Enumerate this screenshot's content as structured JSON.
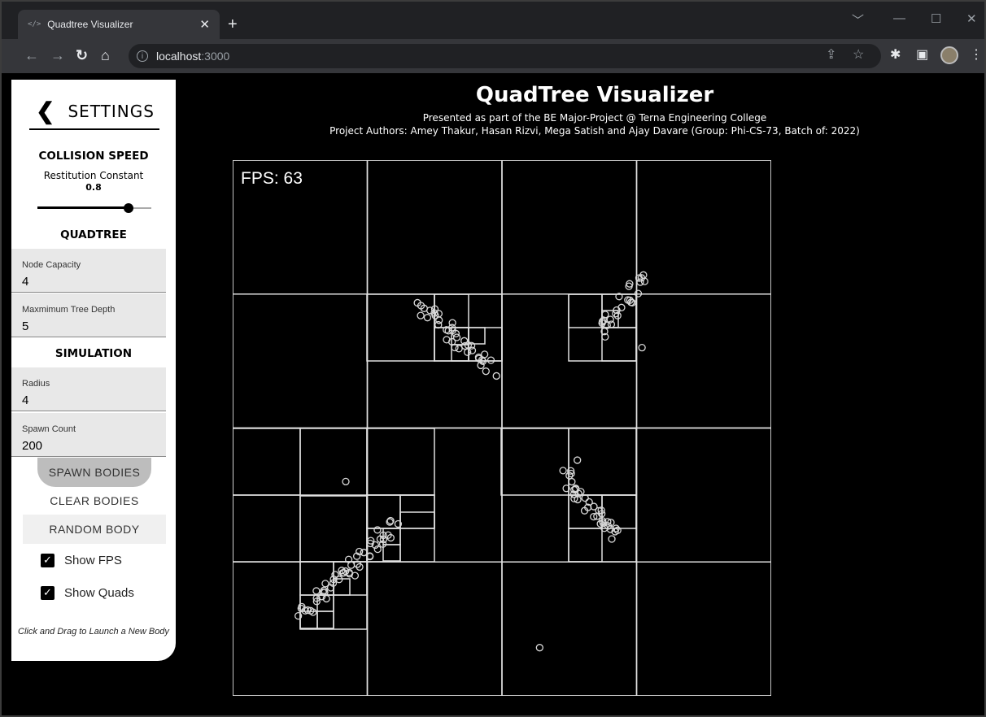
{
  "browser": {
    "tab_title": "Quadtree Visualizer",
    "favicon": "</>",
    "url_host": "localhost",
    "url_port": ":3000",
    "icons": [
      "back-icon",
      "forward-icon",
      "reload-icon",
      "home-icon",
      "info-icon",
      "share-icon",
      "star-icon",
      "extensions-icon",
      "sidepanel-icon",
      "profile-avatar",
      "menu-icon"
    ]
  },
  "header": {
    "title": "QuadTree Visualizer",
    "subtitle": "Presented as part of the BE Major-Project @ Terna Engineering College",
    "authors": "Project Authors: Amey Thakur, Hasan Rizvi, Mega Satish and Ajay Davare (Group: Phi-CS-73, Batch of: 2022)"
  },
  "settings": {
    "title": "SETTINGS",
    "collision": {
      "title": "COLLISION SPEED",
      "label": "Restitution Constant",
      "value": "0.8",
      "slider_fraction": 0.8
    },
    "quadtree": {
      "title": "QUADTREE",
      "node_capacity_label": "Node Capacity",
      "node_capacity_value": "4",
      "max_depth_label": "Maxmimum Tree Depth",
      "max_depth_value": "5"
    },
    "simulation": {
      "title": "SIMULATION",
      "radius_label": "Radius",
      "radius_value": "4",
      "spawn_count_label": "Spawn Count",
      "spawn_count_value": "200"
    },
    "buttons": {
      "spawn": "SPAWN BODIES",
      "clear": "CLEAR BODIES",
      "random": "RANDOM BODY"
    },
    "checkboxes": {
      "show_fps": "Show FPS",
      "show_quads": "Show Quads",
      "show_fps_checked": true,
      "show_quads_checked": true
    },
    "hint": "Click and Drag to Launch a New Body"
  },
  "canvas": {
    "fps_text": "FPS: 63",
    "clusters": [
      {
        "name": "top-center-cluster",
        "start": [
          0.35,
          0.27
        ],
        "end": [
          0.48,
          0.39
        ],
        "count": 38
      },
      {
        "name": "top-right-cluster",
        "start": [
          0.68,
          0.32
        ],
        "end": [
          0.77,
          0.22
        ],
        "count": 26
      },
      {
        "name": "bottom-right-cluster",
        "start": [
          0.62,
          0.59
        ],
        "end": [
          0.71,
          0.7
        ],
        "count": 36
      },
      {
        "name": "bottom-left-cluster",
        "start": [
          0.13,
          0.85
        ],
        "end": [
          0.3,
          0.68
        ],
        "count": 52
      }
    ],
    "stray_bodies": [
      [
        0.76,
        0.35
      ],
      [
        0.64,
        0.56
      ],
      [
        0.21,
        0.6
      ],
      [
        0.57,
        0.91
      ]
    ]
  }
}
